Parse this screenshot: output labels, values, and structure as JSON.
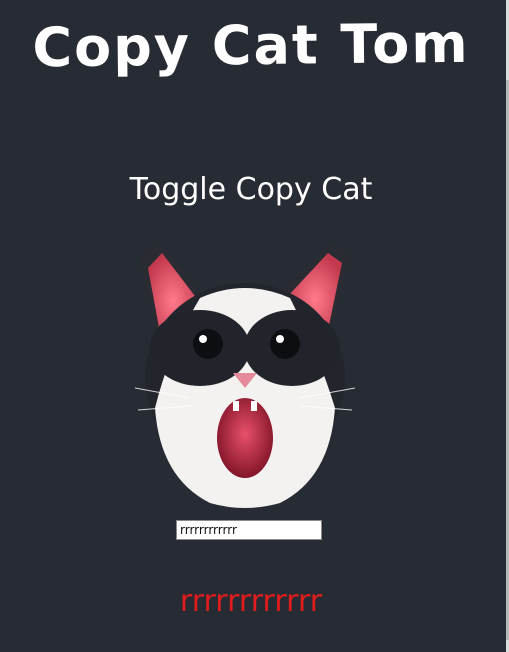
{
  "page": {
    "title": "Copy Cat Tom",
    "toggle_label": "Toggle Copy Cat",
    "input_value": "rrrrrrrrrrrr",
    "echo_text": "rrrrrrrrrrrr"
  },
  "colors": {
    "background": "#272b33",
    "title": "#ffffff",
    "echo": "#e11c1c"
  },
  "icons": {
    "cat_image": "cat-face"
  }
}
